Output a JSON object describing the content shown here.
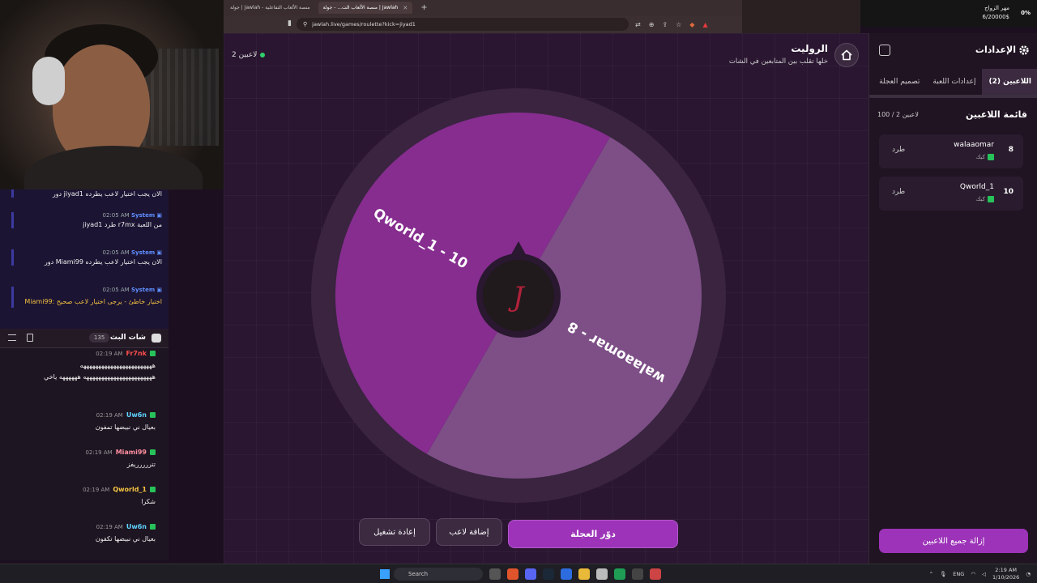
{
  "browser": {
    "tabs": [
      {
        "label": "جولة | Jawlah - منصة الألعاب التفاعلية"
      },
      {
        "label": "منصة الألعاب الت... - جولة | Jawlah"
      }
    ],
    "url": "jawlah.live/games/roulette?kick=jiyad1"
  },
  "overlay": {
    "title": "مهر الزواج",
    "value": "6/20000$",
    "percent": "0%"
  },
  "page": {
    "title": "الروليت",
    "subtitle": "خلها تقلب بين المتابعين في الشات",
    "players_online": "2 لاعبين"
  },
  "wheel": {
    "segments": [
      {
        "label": "walaaomar - 8",
        "color": "#7d4f86"
      },
      {
        "label": "Qworld_1 - 10",
        "color": "#862d8f"
      }
    ]
  },
  "buttons": {
    "spin": "دوّر العجلة",
    "add_player": "إضافة لاعب",
    "restart": "إعادة تشغيل"
  },
  "settings": {
    "title": "الإعدادات",
    "tabs": [
      "اللاعبين (2)",
      "إعدادات اللعبة",
      "تصميم العجلة"
    ],
    "list_title": "قائمة اللاعبين",
    "list_count": "100 / 2 لاعبين",
    "kick_label": "طرد",
    "platform_label": "كيك",
    "players": [
      {
        "number": "8",
        "name": "walaaomar"
      },
      {
        "number": "10",
        "name": "Qworld_1"
      }
    ],
    "remove_all": "إزالة جميع اللاعبين"
  },
  "event_log": [
    {
      "sender": "",
      "time": "",
      "text": "دور jiyad1 الان يجب اختيار لاعب يطرده",
      "warn": false
    },
    {
      "sender": "System",
      "time": "02:05 AM",
      "text": "jiyad1 طرد r7mx من اللعبة",
      "warn": false
    },
    {
      "sender": "System",
      "time": "02:05 AM",
      "text": "دور Miami99 الان يجب اختيار لاعب يطرده",
      "warn": false
    },
    {
      "sender": "System",
      "time": "02:05 AM",
      "text": "Miami99: اختيار خاطئ - يرجى اختيار لاعب صحيح",
      "warn": true
    }
  ],
  "chat": {
    "title": "شات البث",
    "count": "135",
    "messages": [
      {
        "user": "Fr7nk",
        "time": "02:19 AM",
        "color": "#ff4d4d",
        "text": "ههههههههههههههههههههههههه هههههههههههههههههههههههه ههههههه ياخي"
      },
      {
        "user": "Uw6n",
        "time": "02:19 AM",
        "color": "#5fd4ff",
        "text": "بعيال ني نبيضها تمفون"
      },
      {
        "user": "Miami99",
        "time": "02:19 AM",
        "color": "#ff8fa0",
        "text": "تتررررريفز"
      },
      {
        "user": "Qworld_1",
        "time": "02:19 AM",
        "color": "#f5c542",
        "text": "شكرا"
      },
      {
        "user": "Uw6n",
        "time": "02:19 AM",
        "color": "#5fd4ff",
        "text": "بعيال ني نبيضها تكفون"
      }
    ]
  },
  "taskbar": {
    "search": "Search",
    "lang": "ENG",
    "time": "2:19 AM",
    "date": "1/10/2026"
  }
}
